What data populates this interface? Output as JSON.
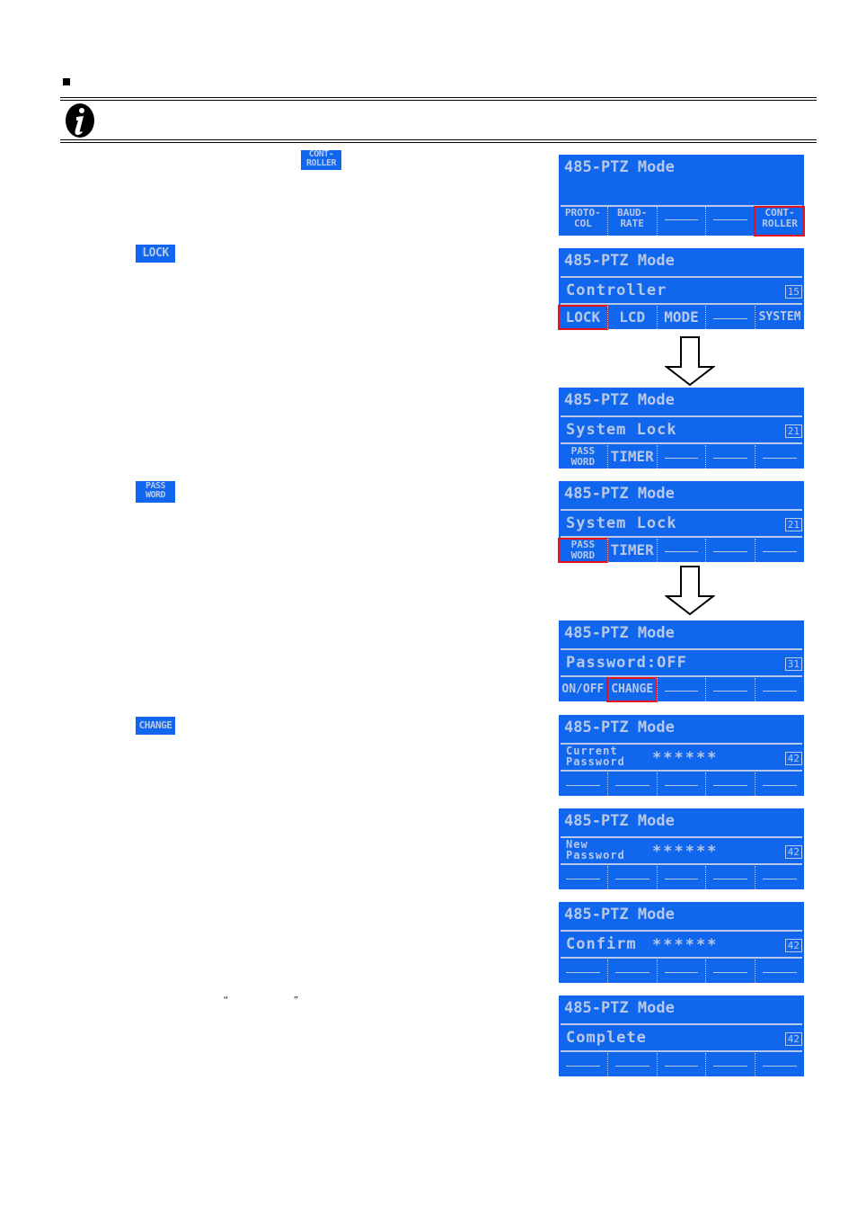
{
  "note": {
    "icon": "info-icon",
    "bullet": "square-bullet"
  },
  "inline_keys": {
    "controller": [
      "CONT-",
      "ROLLER"
    ],
    "lock": "LOCK",
    "password": [
      "PASS",
      "WORD"
    ],
    "change": "CHANGE"
  },
  "quotes": {
    "open": "“",
    "close": "”"
  },
  "screens": [
    {
      "title": "485-PTZ Mode",
      "line2": "",
      "stars": "",
      "code": "",
      "keys": [
        {
          "label": [
            "PROTO-",
            "COL"
          ],
          "highlight": false
        },
        {
          "label": [
            "BAUD-",
            "RATE"
          ],
          "highlight": false
        },
        {
          "label": "",
          "highlight": false
        },
        {
          "label": "",
          "highlight": false
        },
        {
          "label": [
            "CONT-",
            "ROLLER"
          ],
          "highlight": true
        }
      ]
    },
    {
      "title": "485-PTZ Mode",
      "line2": "Controller",
      "stars": "",
      "code": "15",
      "keys": [
        {
          "label": "LOCK",
          "highlight": true
        },
        {
          "label": "LCD",
          "highlight": false
        },
        {
          "label": "MODE",
          "highlight": false
        },
        {
          "label": "",
          "highlight": false
        },
        {
          "label": "SYSTEM",
          "highlight": false
        }
      ]
    },
    {
      "title": "485-PTZ Mode",
      "line2": "System Lock",
      "stars": "",
      "code": "21",
      "keys": [
        {
          "label": [
            "PASS",
            "WORD"
          ],
          "highlight": false
        },
        {
          "label": "TIMER",
          "highlight": false
        },
        {
          "label": "",
          "highlight": false
        },
        {
          "label": "",
          "highlight": false
        },
        {
          "label": "",
          "highlight": false
        }
      ]
    },
    {
      "title": "485-PTZ Mode",
      "line2": "System Lock",
      "stars": "",
      "code": "21",
      "keys": [
        {
          "label": [
            "PASS",
            "WORD"
          ],
          "highlight": true
        },
        {
          "label": "TIMER",
          "highlight": false
        },
        {
          "label": "",
          "highlight": false
        },
        {
          "label": "",
          "highlight": false
        },
        {
          "label": "",
          "highlight": false
        }
      ]
    },
    {
      "title": "485-PTZ Mode",
      "line2": "Password:OFF",
      "stars": "",
      "code": "31",
      "keys": [
        {
          "label": "ON/OFF",
          "highlight": false
        },
        {
          "label": "CHANGE",
          "highlight": true
        },
        {
          "label": "",
          "highlight": false
        },
        {
          "label": "",
          "highlight": false
        },
        {
          "label": "",
          "highlight": false
        }
      ]
    },
    {
      "title": "485-PTZ Mode",
      "line2": [
        "Current",
        "Password"
      ],
      "stars": "******",
      "code": "42",
      "keys": [
        {
          "label": "",
          "highlight": false
        },
        {
          "label": "",
          "highlight": false
        },
        {
          "label": "",
          "highlight": false
        },
        {
          "label": "",
          "highlight": false
        },
        {
          "label": "",
          "highlight": false
        }
      ]
    },
    {
      "title": "485-PTZ Mode",
      "line2": [
        "New",
        "Password"
      ],
      "stars": "******",
      "code": "42",
      "keys": [
        {
          "label": "",
          "highlight": false
        },
        {
          "label": "",
          "highlight": false
        },
        {
          "label": "",
          "highlight": false
        },
        {
          "label": "",
          "highlight": false
        },
        {
          "label": "",
          "highlight": false
        }
      ]
    },
    {
      "title": "485-PTZ Mode",
      "line2": "Confirm",
      "stars": "******",
      "code": "42",
      "keys": [
        {
          "label": "",
          "highlight": false
        },
        {
          "label": "",
          "highlight": false
        },
        {
          "label": "",
          "highlight": false
        },
        {
          "label": "",
          "highlight": false
        },
        {
          "label": "",
          "highlight": false
        }
      ]
    },
    {
      "title": "485-PTZ Mode",
      "line2": "Complete",
      "stars": "",
      "code": "42",
      "keys": [
        {
          "label": "",
          "highlight": false
        },
        {
          "label": "",
          "highlight": false
        },
        {
          "label": "",
          "highlight": false
        },
        {
          "label": "",
          "highlight": false
        },
        {
          "label": "",
          "highlight": false
        }
      ]
    }
  ],
  "colors": {
    "lcd_background": "#1166ee",
    "lcd_text": "#b8c8e8",
    "highlight": "#e8101a"
  }
}
